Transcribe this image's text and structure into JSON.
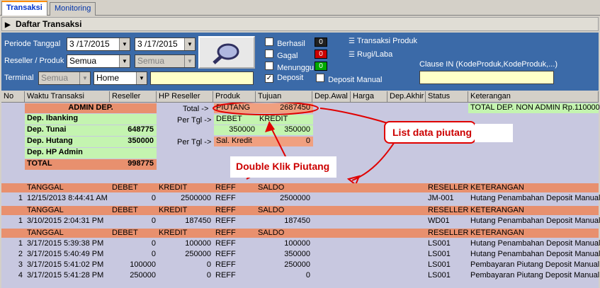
{
  "tabs": [
    {
      "label": "Transaksi",
      "active": true
    },
    {
      "label": "Monitoring",
      "active": false
    }
  ],
  "section_title": "Daftar Transaksi",
  "filters": {
    "periode_label": "Periode Tanggal",
    "date_from": "3 /17/2015",
    "date_to": "3 /17/2015",
    "reseller_label": "Reseller / Produk",
    "reseller_value": "Semua",
    "produk_value": "Semua",
    "terminal_label": "Terminal",
    "terminal_value": "Semua",
    "location_value": "Home",
    "terminal_text": ""
  },
  "statuses": [
    {
      "label": "Berhasil",
      "checked": false,
      "count": "0",
      "color": "#202020"
    },
    {
      "label": "Gagal",
      "checked": false,
      "count": "0",
      "color": "#cc0000"
    },
    {
      "label": "Menunggu",
      "checked": false,
      "count": "0",
      "color": "#00aa00"
    },
    {
      "label": "Deposit",
      "checked": true,
      "count": "",
      "color": ""
    }
  ],
  "deposit_manual_label": "Deposit Manual",
  "report_links": [
    "Transaksi Produk",
    "Rugi/Laba"
  ],
  "clause_label": "Clause IN (KodeProduk,KodeProduk,...)",
  "clause_value": "",
  "columns": [
    "No",
    "Waktu Transaksi",
    "Reseller",
    "HP Reseller",
    "Produk",
    "Tujuan",
    "Dep.Awal",
    "Harga",
    "Dep.Akhir",
    "Status",
    "Keterangan"
  ],
  "summary": {
    "admin_title": "ADMIN DEP.",
    "rows": [
      {
        "label": "Dep. Ibanking",
        "value": ""
      },
      {
        "label": "Dep. Tunai",
        "value": "648775"
      },
      {
        "label": "Dep. Hutang",
        "value": "350000"
      },
      {
        "label": "Dep. HP Admin",
        "value": ""
      }
    ],
    "total_label": "TOTAL",
    "total_value": "998775",
    "total_arrow": "Total ->",
    "piutang_label": "PIUTANG",
    "piutang_value": "2687450",
    "pertgl1": "Per Tgl ->",
    "debet_label": "DEBET",
    "kredit_label": "KREDIT",
    "debet_value": "350000",
    "kredit_value": "350000",
    "pertgl2": "Per Tgl ->",
    "sal_kredit_label": "Sal. Kredit",
    "sal_kredit_value": "0",
    "non_admin": "TOTAL DEP. NON ADMIN Rp.1100000"
  },
  "annotations": {
    "list_piutang": "List data piutang",
    "double_click": "Double Klik Piutang"
  },
  "detail_header": {
    "tanggal": "TANGGAL",
    "debet": "DEBET",
    "kredit": "KREDIT",
    "reff": "REFF",
    "saldo": "SALDO",
    "reseller": "RESELLER",
    "keterangan": "KETERANGAN"
  },
  "detail_groups": [
    {
      "rows": [
        {
          "no": "1",
          "tanggal": "12/15/2013 8:44:41 AM",
          "debet": "0",
          "kredit": "2500000",
          "reff": "REFF",
          "saldo": "2500000",
          "reseller": "JM-001",
          "keterangan": "Hutang Penambahan Deposit Manual"
        }
      ]
    },
    {
      "rows": [
        {
          "no": "1",
          "tanggal": "3/10/2015 2:04:31 PM",
          "debet": "0",
          "kredit": "187450",
          "reff": "REFF",
          "saldo": "187450",
          "reseller": "WD01",
          "keterangan": "Hutang Penambahan Deposit Manual"
        }
      ]
    },
    {
      "rows": [
        {
          "no": "1",
          "tanggal": "3/17/2015 5:39:38 PM",
          "debet": "0",
          "kredit": "100000",
          "reff": "REFF",
          "saldo": "100000",
          "reseller": "LS001",
          "keterangan": "Hutang Penambahan Deposit Manual"
        },
        {
          "no": "2",
          "tanggal": "3/17/2015 5:40:49 PM",
          "debet": "0",
          "kredit": "250000",
          "reff": "REFF",
          "saldo": "350000",
          "reseller": "LS001",
          "keterangan": "Hutang Penambahan Deposit Manual"
        },
        {
          "no": "3",
          "tanggal": "3/17/2015 5:41:02 PM",
          "debet": "100000",
          "kredit": "0",
          "reff": "REFF",
          "saldo": "250000",
          "reseller": "LS001",
          "keterangan": "Pembayaran Piutang Deposit Manual"
        },
        {
          "no": "4",
          "tanggal": "3/17/2015 5:41:28 PM",
          "debet": "250000",
          "kredit": "0",
          "reff": "REFF",
          "saldo": "0",
          "reseller": "LS001",
          "keterangan": "Pembayaran Piutang Deposit Manual"
        }
      ]
    }
  ]
}
